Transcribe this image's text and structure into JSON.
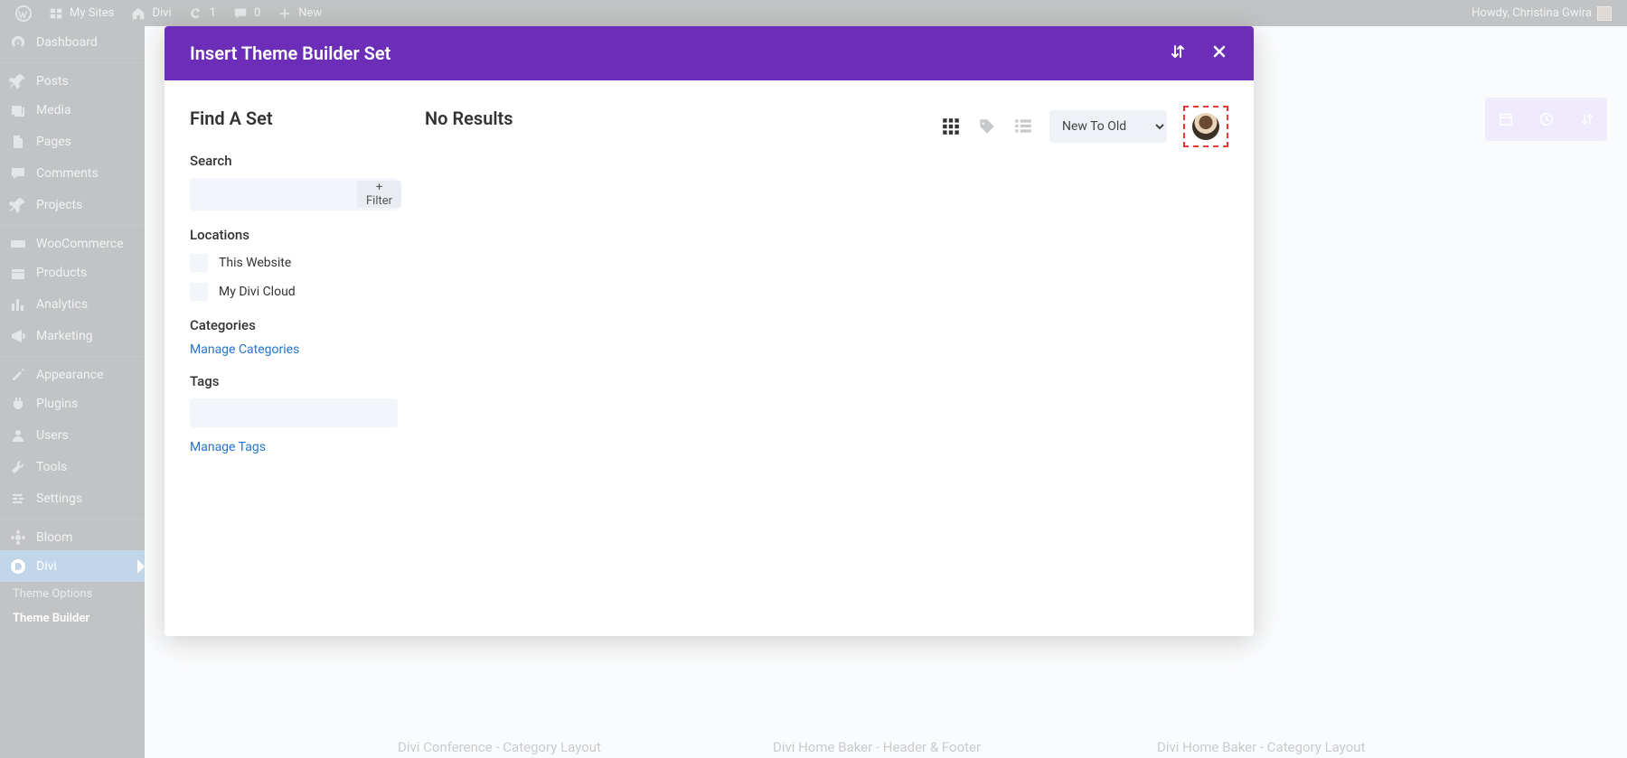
{
  "adminbar": {
    "my_sites": "My Sites",
    "site_name": "Divi",
    "updates_count": "1",
    "comments_count": "0",
    "new": "New",
    "howdy": "Howdy, Christina Gwira"
  },
  "sidebar": {
    "items": [
      {
        "label": "Dashboard",
        "icon": "dashboard"
      },
      {
        "label": "Posts",
        "icon": "pin"
      },
      {
        "label": "Media",
        "icon": "media"
      },
      {
        "label": "Pages",
        "icon": "pages"
      },
      {
        "label": "Comments",
        "icon": "comment"
      },
      {
        "label": "Projects",
        "icon": "pin"
      },
      {
        "label": "WooCommerce",
        "icon": "woo"
      },
      {
        "label": "Products",
        "icon": "products"
      },
      {
        "label": "Analytics",
        "icon": "analytics"
      },
      {
        "label": "Marketing",
        "icon": "marketing"
      },
      {
        "label": "Appearance",
        "icon": "appearance"
      },
      {
        "label": "Plugins",
        "icon": "plugins"
      },
      {
        "label": "Users",
        "icon": "users"
      },
      {
        "label": "Tools",
        "icon": "tools"
      },
      {
        "label": "Settings",
        "icon": "settings"
      },
      {
        "label": "Bloom",
        "icon": "bloom"
      },
      {
        "label": "Divi",
        "icon": "divi",
        "active": true
      }
    ],
    "subitems": [
      "Theme Options",
      "Theme Builder"
    ]
  },
  "modal": {
    "title": "Insert Theme Builder Set",
    "find_a_set": "Find A Set",
    "search_label": "Search",
    "filter_btn": "+ Filter",
    "locations_label": "Locations",
    "locations": [
      {
        "label": "This Website"
      },
      {
        "label": "My Divi Cloud"
      }
    ],
    "categories_label": "Categories",
    "manage_categories": "Manage Categories",
    "tags_label": "Tags",
    "manage_tags": "Manage Tags",
    "results_title": "No Results",
    "sort": {
      "selected": "New To Old"
    }
  },
  "background": {
    "card_names": [
      "Divi Conference - Category Layout",
      "Divi Home Baker - Header & Footer",
      "Divi Home Baker - Category Layout"
    ]
  }
}
